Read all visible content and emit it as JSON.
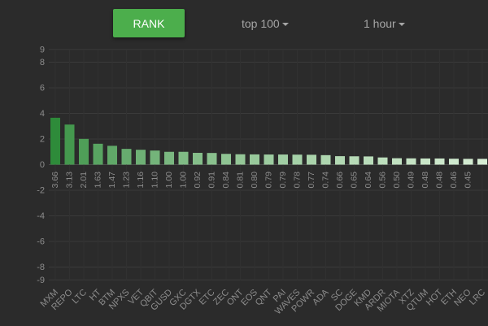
{
  "controls": {
    "rank_label": "RANK",
    "top_dropdown": "top 100",
    "time_dropdown": "1 hour"
  },
  "colors": {
    "background": "#2b2b2b",
    "grid": "#3a3a3a",
    "axis_text": "#8c8c8c",
    "bar_dark": "#2e8b3a",
    "bar_light": "#d6edd4",
    "button": "#4cae4c"
  },
  "chart_data": {
    "type": "bar",
    "categories": [
      "MXM",
      "REPO",
      "LTC",
      "HT",
      "BTM",
      "NPXS",
      "VET",
      "QBIT",
      "GUSD",
      "GXC",
      "DGTX",
      "ETC",
      "ZEC",
      "ONT",
      "EOS",
      "QNT",
      "PAI",
      "WAVES",
      "POWR",
      "ADA",
      "SC",
      "DOGE",
      "KMD",
      "ARDR",
      "MIOTA",
      "XTZ",
      "QTUM",
      "HOT",
      "ETH",
      "NEO",
      "LRC"
    ],
    "values": [
      3.66,
      3.13,
      2.01,
      1.63,
      1.47,
      1.23,
      1.16,
      1.1,
      1.0,
      1.0,
      0.92,
      0.91,
      0.84,
      0.81,
      0.8,
      0.79,
      0.79,
      0.78,
      0.77,
      0.74,
      0.66,
      0.65,
      0.64,
      0.56,
      0.5,
      0.49,
      0.48,
      0.48,
      0.46,
      0.45,
      0.45
    ],
    "value_labels": [
      "3.66",
      "3.13",
      "2.01",
      "1.63",
      "1.47",
      "1.23",
      "1.16",
      "1.10",
      "1.00",
      "1.00",
      "0.92",
      "0.91",
      "0.84",
      "0.81",
      "0.80",
      "0.79",
      "0.79",
      "0.78",
      "0.77",
      "0.74",
      "0.66",
      "0.65",
      "0.64",
      "0.56",
      "0.50",
      "0.49",
      "0.48",
      "0.48",
      "0.46",
      "0.45",
      ""
    ],
    "ylim": [
      -9,
      9
    ],
    "y_ticks": [
      {
        "v": 9,
        "label": "9"
      },
      {
        "v": 8,
        "label": "8"
      },
      {
        "v": 6,
        "label": "6"
      },
      {
        "v": 4,
        "label": "4"
      },
      {
        "v": 2,
        "label": "2"
      },
      {
        "v": 0,
        "label": "0"
      },
      {
        "v": -2,
        "label": "-2"
      },
      {
        "v": -4,
        "label": "-4"
      },
      {
        "v": -6,
        "label": "-6"
      },
      {
        "v": -8,
        "label": "-8"
      },
      {
        "v": -9,
        "label": "-9"
      }
    ],
    "grid": true,
    "title": "",
    "xlabel": "",
    "ylabel": ""
  }
}
